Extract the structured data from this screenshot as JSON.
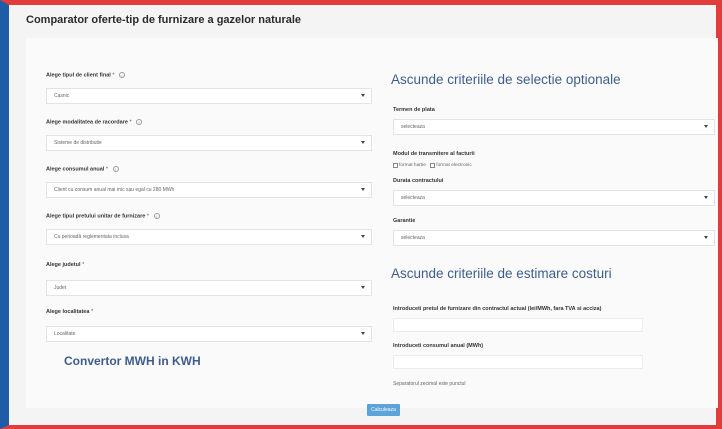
{
  "page": {
    "title": "Comparator oferte-tip de furnizare a gazelor naturale"
  },
  "left_form": {
    "client_type": {
      "label": "Alege tipul de client final",
      "value": "Casnic"
    },
    "billing_method": {
      "label": "Alege modalitatea de racordare",
      "value": "Sisteme de distributie"
    },
    "annual_consumption": {
      "label": "Alege consumul anual",
      "value": "Client cu consum anual mai mic sau egal cu 280 MWh"
    },
    "price_type": {
      "label": "Alege tipul pretului unitar de furnizare",
      "value": "Cu perioadă reglementata inclusa"
    },
    "county": {
      "label": "Alege judetul",
      "value": "Judet"
    },
    "locality": {
      "label": "Alege localitatea",
      "value": "Localitate"
    },
    "required_mark": "*",
    "info_glyph": "i"
  },
  "convertor": {
    "label": "Convertor MWH in KWH"
  },
  "optional_criteria": {
    "heading": "Ascunde criteriile de selectie optionale",
    "payment_term": {
      "label": "Termen de plata",
      "value": "selecteaza"
    },
    "invoice_delivery": {
      "label": "Modul de transmitere al facturii",
      "options": [
        "format hartie",
        "format electronic"
      ]
    },
    "contract_duration": {
      "label": "Durata contractului",
      "value": "selecteaza"
    },
    "guarantee": {
      "label": "Garantie",
      "value": "selecteaza"
    }
  },
  "cost_criteria": {
    "heading": "Ascunde criteriile de estimare costuri",
    "current_price": {
      "label": "Introduceti pretul de furnizare din contractul actual (lei/MWh, fara TVA si acciza)"
    },
    "annual_consumption_input": {
      "label": "Introduceti consumul anual (MWh)"
    },
    "separator_hint": "Separatorul zecimal este punctul"
  },
  "actions": {
    "calculate_label": "Calculeaza"
  },
  "colors": {
    "accent_blue": "#3d5d8c",
    "button_blue": "#5ba3d8",
    "frame_red": "#e23b3b",
    "frame_left_blue": "#1e5ca8"
  }
}
